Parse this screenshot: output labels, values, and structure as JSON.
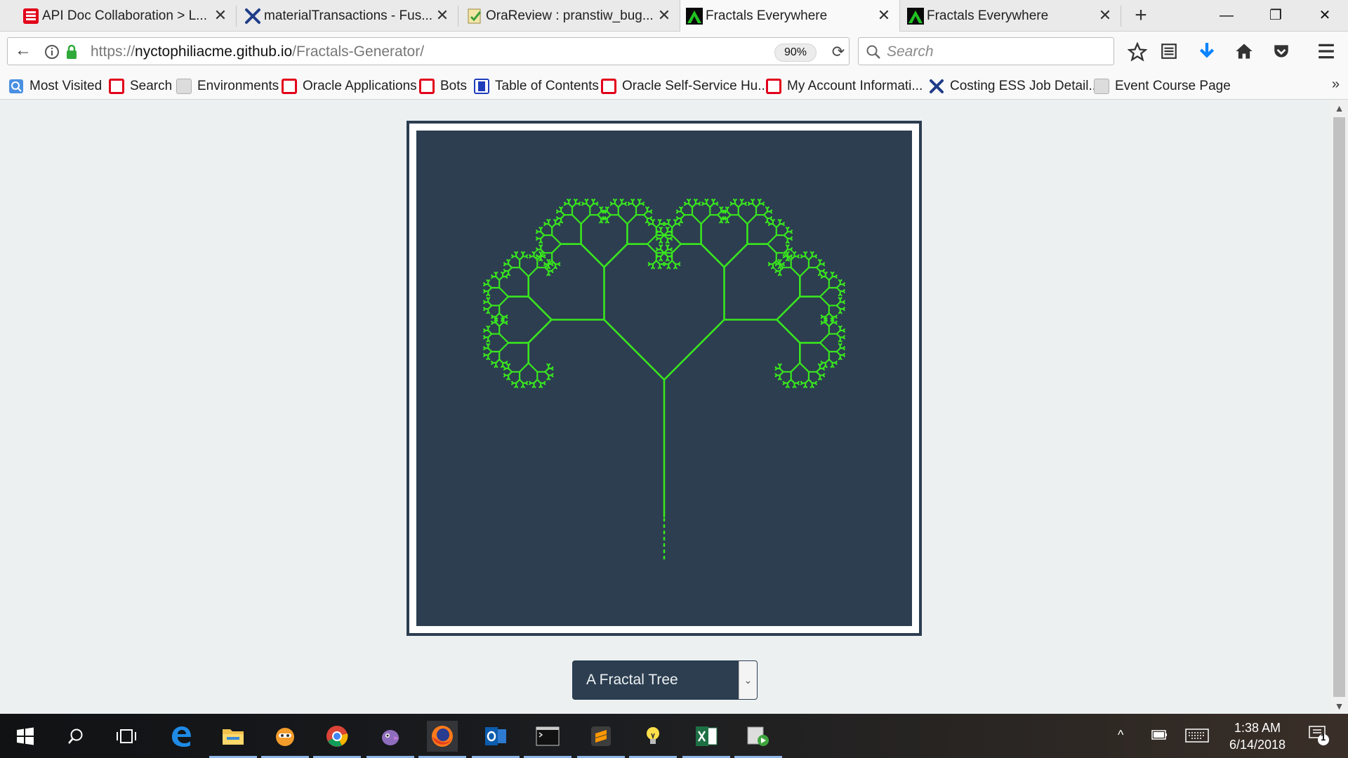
{
  "tabs": [
    {
      "label": "API Doc Collaboration > L...",
      "icon": "oracle-list-icon"
    },
    {
      "label": "materialTransactions - Fus...",
      "icon": "wrench-x-icon"
    },
    {
      "label": "OraReview : pranstiw_bug...",
      "icon": "review-note-icon"
    },
    {
      "label": "Fractals Everywhere",
      "icon": "fractal-favicon-icon",
      "active": true
    },
    {
      "label": "Fractals Everywhere",
      "icon": "fractal-favicon-icon"
    }
  ],
  "window_controls": {
    "minimize": "—",
    "restore": "❐",
    "close": "✕"
  },
  "nav": {
    "url_prefix": "https://",
    "url_host": "nyctophiliacme.github.io",
    "url_path": "/Fractals-Generator/",
    "zoom": "90%",
    "search_placeholder": "Search"
  },
  "bookmarks": [
    {
      "label": "Most Visited",
      "icon": "most-visited-icon"
    },
    {
      "label": "Search",
      "icon": "oracle-icon"
    },
    {
      "label": "Environments",
      "icon": "generic-page-icon"
    },
    {
      "label": "Oracle Applications",
      "icon": "oracle-icon"
    },
    {
      "label": "Bots",
      "icon": "oracle-icon"
    },
    {
      "label": "Table of Contents",
      "icon": "docs-icon"
    },
    {
      "label": "Oracle Self-Service Hu...",
      "icon": "oracle-icon"
    },
    {
      "label": "My Account Informati...",
      "icon": "oracle-icon"
    },
    {
      "label": "Costing ESS Job Detail...",
      "icon": "wrench-x-icon"
    },
    {
      "label": "Event Course Page",
      "icon": "generic-page-icon"
    }
  ],
  "page": {
    "fractal_color": "#39e61e",
    "canvas_bg": "#2c3e50",
    "select_value": "A Fractal Tree"
  },
  "taskbar": {
    "time": "1:38 AM",
    "date": "6/14/2018",
    "notification_count": "1",
    "apps": [
      "start-icon",
      "search-icon",
      "task-view-icon",
      "edge-icon",
      "file-explorer-icon",
      "scratch-app-icon",
      "chrome-icon",
      "pidgin-icon",
      "firefox-icon",
      "outlook-icon",
      "cmd-icon",
      "sublime-icon",
      "idea-icon",
      "excel-icon",
      "media-app-icon"
    ]
  }
}
